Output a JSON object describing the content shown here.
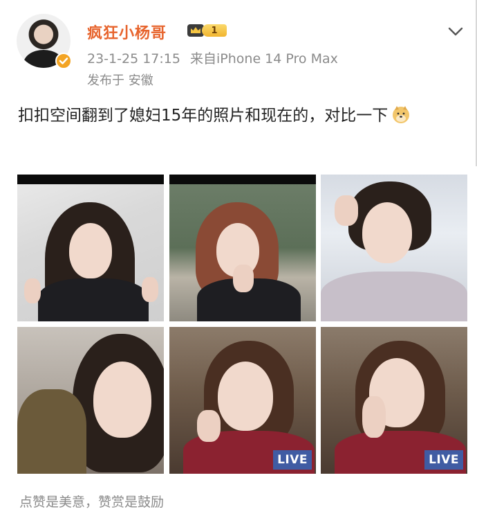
{
  "post": {
    "author": "疯狂小杨哥",
    "vip_level": "1",
    "timestamp": "23-1-25 17:15",
    "source": "来自iPhone 14 Pro Max",
    "location": "发布于 安徽",
    "text": "扣扣空间翻到了媳妇15年的照片和现在的，对比一下",
    "footer": "点赞是美意，赞赏是鼓励"
  },
  "photos": [
    {
      "live": ""
    },
    {
      "live": ""
    },
    {
      "live": ""
    },
    {
      "live": ""
    },
    {
      "live": "LIVE"
    },
    {
      "live": "LIVE"
    }
  ],
  "icons": {
    "avatar": "avatar-image",
    "verified": "verified-badge-icon",
    "vip": "crown-icon",
    "more": "chevron-down-icon",
    "emoji": "doge-emoji-icon"
  },
  "colors": {
    "username": "#e7642d",
    "meta": "#8a8a8a",
    "live_badge": "#3c60aa",
    "vip_gold": "#f1b52f"
  }
}
